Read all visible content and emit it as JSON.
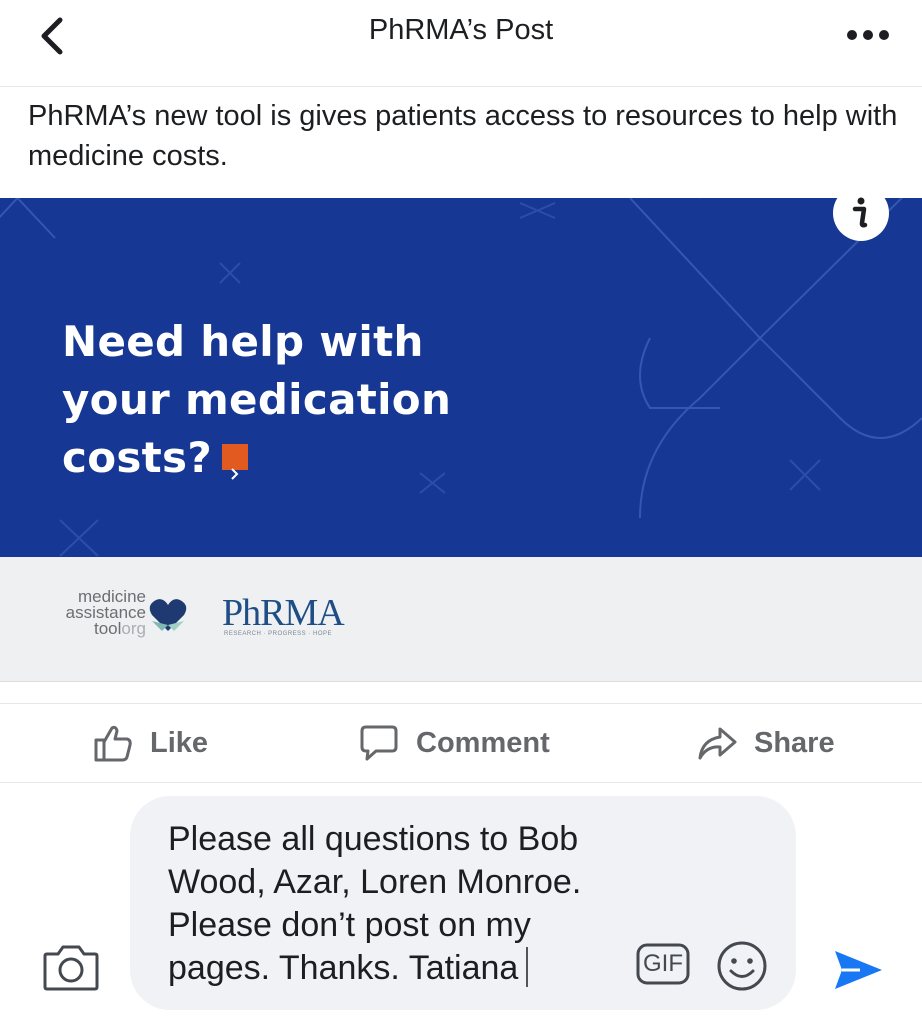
{
  "header": {
    "title": "PhRMA’s Post",
    "back_icon": "chevron-left-icon",
    "more_icon": "more-dots-icon"
  },
  "post": {
    "caption": "PhRMA’s new tool is gives patients access to resources to help with medicine costs.",
    "banner": {
      "headline_lines": [
        "Need help with",
        "your medication",
        "costs?"
      ],
      "background_color": "#163894",
      "cta_color": "#e25a20",
      "info_icon": "info-icon"
    },
    "logos": {
      "mat_lines": [
        "medicine",
        "assistance",
        "tool",
        "org"
      ],
      "phrma_word": "PhRMA",
      "phrma_tagline": "RESEARCH · PROGRESS · HOPE"
    }
  },
  "actions": {
    "like": "Like",
    "comment": "Comment",
    "share": "Share"
  },
  "composer": {
    "text": "Please all questions to Bob Wood, Azar, Loren Monroe. Please don’t post on my pages. Thanks. Tatiana",
    "gif_label": "GIF",
    "camera_icon": "camera-icon",
    "emoji_icon": "emoji-icon",
    "send_icon": "send-icon",
    "accent_color": "#1877f2"
  }
}
